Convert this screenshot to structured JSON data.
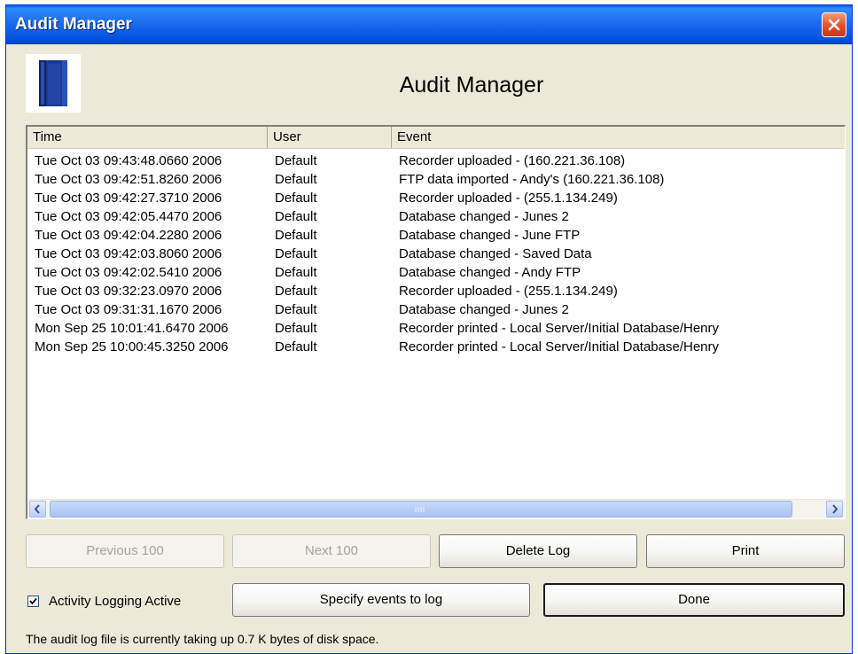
{
  "window": {
    "title": "Audit Manager"
  },
  "header": {
    "title": "Audit Manager",
    "icon": "binder-book-icon"
  },
  "table": {
    "columns": [
      "Time",
      "User",
      "Event"
    ],
    "rows": [
      {
        "time": "Tue Oct 03 09:43:48.0660 2006",
        "user": "Default",
        "event": "Recorder uploaded -  (160.221.36.108)"
      },
      {
        "time": "Tue Oct 03 09:42:51.8260 2006",
        "user": "Default",
        "event": "FTP data imported - Andy's (160.221.36.108)"
      },
      {
        "time": "Tue Oct 03 09:42:27.3710 2006",
        "user": "Default",
        "event": "Recorder uploaded -  (255.1.134.249)"
      },
      {
        "time": "Tue Oct 03 09:42:05.4470 2006",
        "user": "Default",
        "event": "Database changed - Junes 2"
      },
      {
        "time": "Tue Oct 03 09:42:04.2280 2006",
        "user": "Default",
        "event": "Database changed - June FTP"
      },
      {
        "time": "Tue Oct 03 09:42:03.8060 2006",
        "user": "Default",
        "event": "Database changed - Saved Data"
      },
      {
        "time": "Tue Oct 03 09:42:02.5410 2006",
        "user": "Default",
        "event": "Database changed - Andy FTP"
      },
      {
        "time": "Tue Oct 03 09:32:23.0970 2006",
        "user": "Default",
        "event": "Recorder uploaded -  (255.1.134.249)"
      },
      {
        "time": "Tue Oct 03 09:31:31.1670 2006",
        "user": "Default",
        "event": "Database changed - Junes 2"
      },
      {
        "time": "Mon Sep 25 10:01:41.6470 2006",
        "user": "Default",
        "event": "Recorder printed - Local Server/Initial Database/Henry"
      },
      {
        "time": "Mon Sep 25 10:00:45.3250 2006",
        "user": "Default",
        "event": "Recorder printed - Local Server/Initial Database/Henry"
      }
    ]
  },
  "buttons": {
    "previous": "Previous 100",
    "next": "Next 100",
    "delete_log": "Delete Log",
    "print": "Print",
    "specify_events": "Specify events to log",
    "done": "Done"
  },
  "logging": {
    "label": "Activity Logging Active",
    "checked": true
  },
  "status": "The audit log file is currently taking up 0.7 K bytes of disk space.",
  "colors": {
    "titlebar": "#0a5ae8",
    "close": "#e3502a",
    "face": "#ece9d8",
    "scroll_thumb": "#b9cdf5"
  }
}
